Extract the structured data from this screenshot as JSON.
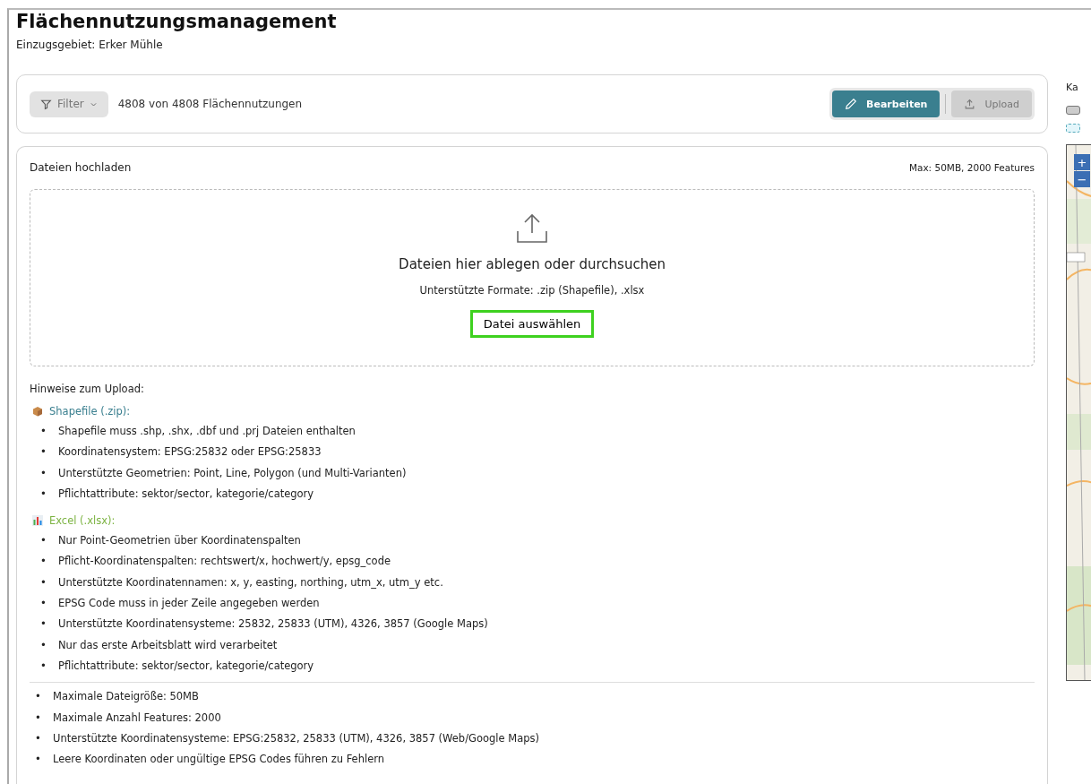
{
  "page": {
    "title": "Flächennutzungsmanagement",
    "subtitle": "Einzugsgebiet: Erker Mühle"
  },
  "toolbar": {
    "filter": {
      "label": "Filter",
      "expanded": false
    },
    "count": "4808 von 4808 Flächennutzungen",
    "modes": [
      {
        "label": "Bearbeiten",
        "selected": true
      },
      {
        "label": "Upload",
        "selected": false
      }
    ]
  },
  "bullet": "•",
  "upload": {
    "title": "Dateien hochladen",
    "limit": "Max: 50MB, 2000 Features",
    "dropzone": {
      "headline": "Dateien hier ablegen oder durchsuchen",
      "formats": "Unterstützte Formate: .zip (Shapefile), .xlsx",
      "button": {
        "label": "Datei auswählen",
        "highlighted": true
      }
    },
    "hints_title": "Hinweise zum Upload:",
    "sections": [
      {
        "kind": "shapefile",
        "title": "Shapefile (.zip):",
        "color": "#3a7f8f",
        "items": [
          "Shapefile muss .shp, .shx, .dbf und .prj Dateien enthalten",
          "Koordinatensystem: EPSG:25832 oder EPSG:25833",
          "Unterstützte Geometrien: Point, Line, Polygon (und Multi-Varianten)",
          "Pflichtattribute: sektor/sector, kategorie/category"
        ]
      },
      {
        "kind": "excel",
        "title": "Excel (.xlsx):",
        "color": "#7cb342",
        "items": [
          "Nur Point-Geometrien über Koordinatenspalten",
          "Pflicht-Koordinatenspalten: rechtswert/x, hochwert/y, epsg_code",
          "Unterstützte Koordinatennamen: x, y, easting, northing, utm_x, utm_y etc.",
          "EPSG Code muss in jeder Zeile angegeben werden",
          "Unterstützte Koordinatensysteme: 25832, 25833 (UTM), 4326, 3857 (Google Maps)",
          "Nur das erste Arbeitsblatt wird verarbeitet",
          "Pflichtattribute: sektor/sector, kategorie/category"
        ]
      }
    ],
    "general": [
      "Maximale Dateigröße: 50MB",
      "Maximale Anzahl Features: 2000",
      "Unterstützte Koordinatensysteme: EPSG:25832, 25833 (UTM), 4326, 3857 (Web/Google Maps)",
      "Leere Koordinaten oder ungültige EPSG Codes führen zu Fehlern"
    ]
  },
  "map_panel": {
    "title": "Ka",
    "legend": [
      {
        "kind": "solid"
      },
      {
        "kind": "dashed"
      }
    ],
    "zoom": [
      "+",
      "−"
    ]
  }
}
